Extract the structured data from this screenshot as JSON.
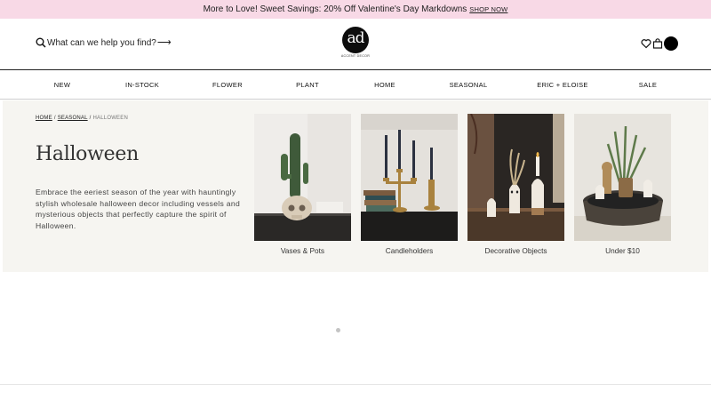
{
  "promo": {
    "text": "More to Love! Sweet Savings: 20% Off Valentine's Day Markdowns",
    "link": "SHOP NOW"
  },
  "header": {
    "search_text": "What can we help you find?",
    "logo_mark": "ad",
    "logo_text": "ACCENT DECOR"
  },
  "nav": [
    {
      "label": "NEW"
    },
    {
      "label": "IN-STOCK"
    },
    {
      "label": "FLOWER"
    },
    {
      "label": "PLANT"
    },
    {
      "label": "HOME"
    },
    {
      "label": "SEASONAL"
    },
    {
      "label": "ERIC + ELOISE"
    },
    {
      "label": "SALE"
    }
  ],
  "breadcrumb": {
    "home": "HOME",
    "seasonal": "SEASONAL",
    "current": "HALLOWEEN",
    "sep": "/"
  },
  "hero": {
    "title": "Halloween",
    "description": "Embrace the eeriest season of the year with hauntingly stylish wholesale halloween decor including vessels and mysterious objects that perfectly capture the spirit of Halloween."
  },
  "categories": [
    {
      "label": "Vases & Pots"
    },
    {
      "label": "Candleholders"
    },
    {
      "label": "Decorative Objects"
    },
    {
      "label": "Under $10"
    }
  ],
  "colors": {
    "promo_bg": "#f8d9e6",
    "hero_bg": "#f6f5f1",
    "text": "#1a1a1a"
  }
}
